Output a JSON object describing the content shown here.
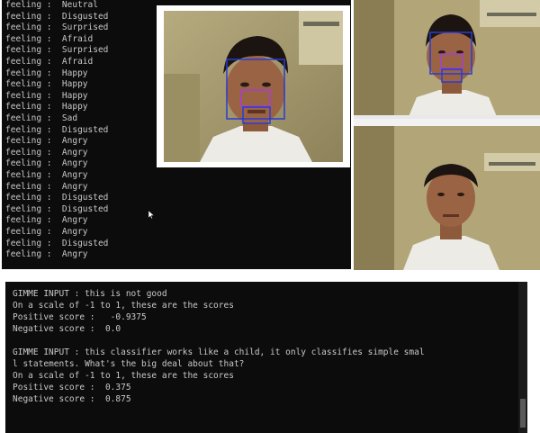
{
  "top_console": {
    "lines": [
      "feeling :  Neutral",
      "feeling :  Disgusted",
      "feeling :  Surprised",
      "feeling :  Afraid",
      "feeling :  Surprised",
      "feeling :  Afraid",
      "feeling :  Happy",
      "feeling :  Happy",
      "feeling :  Happy",
      "feeling :  Happy",
      "feeling :  Sad",
      "feeling :  Disgusted",
      "feeling :  Angry",
      "feeling :  Angry",
      "feeling :  Angry",
      "feeling :  Angry",
      "feeling :  Angry",
      "feeling :  Disgusted",
      "feeling :  Disgusted",
      "feeling :  Angry",
      "feeling :  Angry",
      "feeling :  Disgusted",
      "feeling :  Angry"
    ]
  },
  "bottom_console": {
    "lines": [
      "GIMME INPUT : this is not good",
      "On a scale of -1 to 1, these are the scores",
      "Positive score :   -0.9375",
      "Negative score :  0.0",
      "",
      "GIMME INPUT : this classifier works like a child, it only classifies simple smal",
      "l statements. What's the big deal about that?",
      "On a scale of -1 to 1, these are the scores",
      "Positive score :  0.375",
      "Negative score :  0.875"
    ]
  },
  "colors": {
    "console_bg": "#0c0c0c",
    "console_text": "#c8c8c8",
    "face_box": "#2a3bd6",
    "feature_box": "#a43fd0"
  },
  "icons": [
    "mouse-cursor-icon"
  ]
}
